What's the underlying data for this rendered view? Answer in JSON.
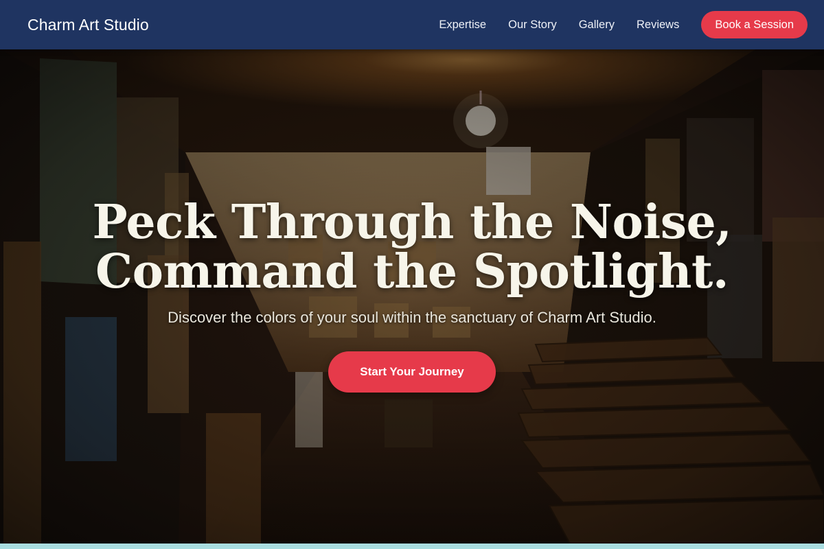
{
  "nav": {
    "brand": "Charm Art Studio",
    "links": [
      "Expertise",
      "Our Story",
      "Gallery",
      "Reviews"
    ],
    "cta": "Book a Session"
  },
  "hero": {
    "headline_line1": "Peck Through the Noise,",
    "headline_line2": "Command the Spotlight.",
    "subheadline": "Discover the colors of your soul within the sanctuary of Charm Art Studio.",
    "cta": "Start Your Journey",
    "background": "art-gallery-interior-photo"
  },
  "colors": {
    "nav_bg": "#1f3461",
    "accent": "#e63a4a",
    "strip": "#a9dde0"
  }
}
